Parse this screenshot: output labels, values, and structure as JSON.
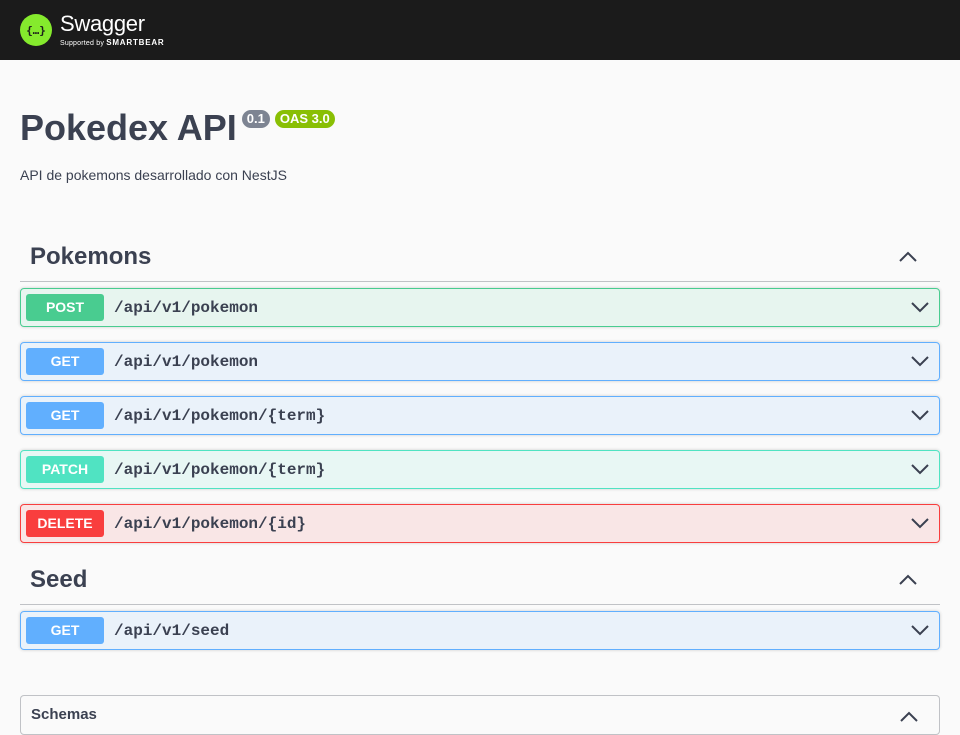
{
  "topbar": {
    "brand": "Swagger",
    "sub_prefix": "Supported by",
    "sub_brand": "SMARTBEAR"
  },
  "info": {
    "title": "Pokedex API",
    "version": "0.1",
    "oas": "OAS 3.0",
    "description": "API de pokemons desarrollado con NestJS"
  },
  "tags": [
    {
      "name": "Pokemons",
      "operations": [
        {
          "method": "POST",
          "path": "/api/v1/pokemon"
        },
        {
          "method": "GET",
          "path": "/api/v1/pokemon"
        },
        {
          "method": "GET",
          "path": "/api/v1/pokemon/{term}"
        },
        {
          "method": "PATCH",
          "path": "/api/v1/pokemon/{term}"
        },
        {
          "method": "DELETE",
          "path": "/api/v1/pokemon/{id}"
        }
      ]
    },
    {
      "name": "Seed",
      "operations": [
        {
          "method": "GET",
          "path": "/api/v1/seed"
        }
      ]
    }
  ],
  "schemas": {
    "title": "Schemas"
  },
  "colors": {
    "post": "#49cc90",
    "get": "#61affe",
    "patch": "#50e3c2",
    "delete": "#f93e3e",
    "topbar": "#1b1b1b",
    "logo": "#85ea2d"
  },
  "icons": {
    "logo": "swagger-logo-icon",
    "expand": "chevron-down-icon",
    "collapse": "chevron-up-icon"
  }
}
